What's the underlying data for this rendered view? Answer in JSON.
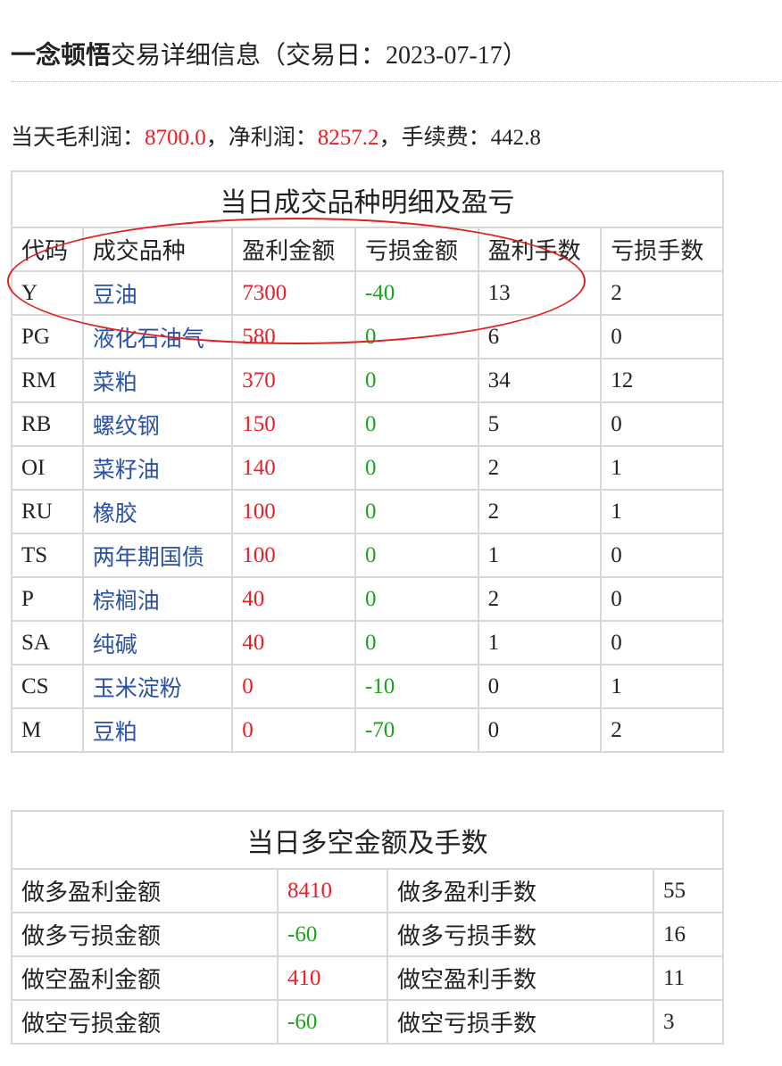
{
  "page": {
    "title_bold": "一念顿悟",
    "title_rest": "交易详细信息（交易日：",
    "trade_date": "2023-07-17",
    "title_close": "）"
  },
  "summary": {
    "gross_label": "当天毛利润：",
    "gross_value": "8700.0",
    "sep1": "，",
    "net_label": "净利润：",
    "net_value": "8257.2",
    "sep2": "，",
    "fee_label": "手续费：",
    "fee_value": "442.8"
  },
  "detail_table": {
    "caption": "当日成交品种明细及盈亏",
    "headers": [
      "代码",
      "成交品种",
      "盈利金额",
      "亏损金额",
      "盈利手数",
      "亏损手数"
    ],
    "rows": [
      {
        "code": "Y",
        "name": "豆油",
        "profit": "7300",
        "loss": "-40",
        "win_lots": "13",
        "loss_lots": "2"
      },
      {
        "code": "PG",
        "name": "液化石油气",
        "profit": "580",
        "loss": "0",
        "win_lots": "6",
        "loss_lots": "0"
      },
      {
        "code": "RM",
        "name": "菜粕",
        "profit": "370",
        "loss": "0",
        "win_lots": "34",
        "loss_lots": "12"
      },
      {
        "code": "RB",
        "name": "螺纹钢",
        "profit": "150",
        "loss": "0",
        "win_lots": "5",
        "loss_lots": "0"
      },
      {
        "code": "OI",
        "name": "菜籽油",
        "profit": "140",
        "loss": "0",
        "win_lots": "2",
        "loss_lots": "1"
      },
      {
        "code": "RU",
        "name": "橡胶",
        "profit": "100",
        "loss": "0",
        "win_lots": "2",
        "loss_lots": "1"
      },
      {
        "code": "TS",
        "name": "两年期国债",
        "profit": "100",
        "loss": "0",
        "win_lots": "1",
        "loss_lots": "0"
      },
      {
        "code": "P",
        "name": "棕榈油",
        "profit": "40",
        "loss": "0",
        "win_lots": "2",
        "loss_lots": "0"
      },
      {
        "code": "SA",
        "name": "纯碱",
        "profit": "40",
        "loss": "0",
        "win_lots": "1",
        "loss_lots": "0"
      },
      {
        "code": "CS",
        "name": "玉米淀粉",
        "profit": "0",
        "loss": "-10",
        "win_lots": "0",
        "loss_lots": "1"
      },
      {
        "code": "M",
        "name": "豆粕",
        "profit": "0",
        "loss": "-70",
        "win_lots": "0",
        "loss_lots": "2"
      }
    ]
  },
  "longshort_table": {
    "caption": "当日多空金额及手数",
    "rows": [
      {
        "amt_label": "做多盈利金额",
        "amt": "8410",
        "amt_color": "red",
        "lots_label": "做多盈利手数",
        "lots": "55"
      },
      {
        "amt_label": "做多亏损金额",
        "amt": "-60",
        "amt_color": "green",
        "lots_label": "做多亏损手数",
        "lots": "16"
      },
      {
        "amt_label": "做空盈利金额",
        "amt": "410",
        "amt_color": "red",
        "lots_label": "做空盈利手数",
        "lots": "11"
      },
      {
        "amt_label": "做空亏损金额",
        "amt": "-60",
        "amt_color": "green",
        "lots_label": "做空亏损手数",
        "lots": "3"
      }
    ]
  },
  "colors": {
    "profit": "#ee1c25",
    "loss": "#1aa51a",
    "link": "#2a51a8",
    "annotation": "#e02020"
  }
}
